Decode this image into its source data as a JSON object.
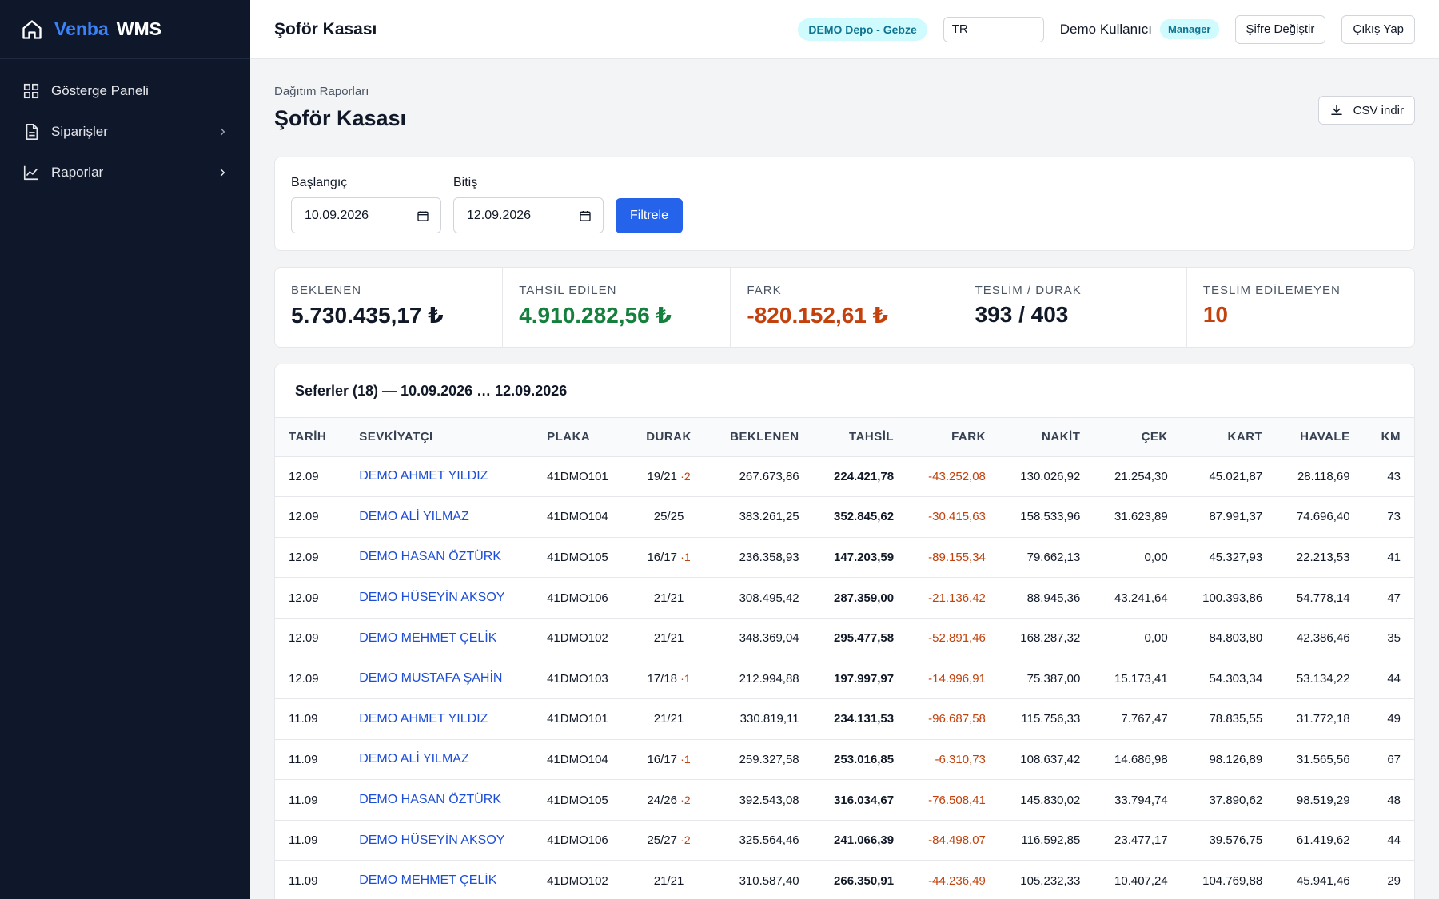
{
  "brand": {
    "part1": "Venba",
    "part2": "WMS"
  },
  "sidebar": {
    "items": [
      {
        "label": "Gösterge Paneli",
        "icon": "grid-icon"
      },
      {
        "label": "Siparişler",
        "icon": "document-icon",
        "has_children": true
      },
      {
        "label": "Raporlar",
        "icon": "chart-line-icon",
        "has_children": true
      }
    ]
  },
  "topbar": {
    "title": "Şoför Kasası",
    "depot": "DEMO Depo - Gebze",
    "language": "TR",
    "user": "Demo Kullanıcı",
    "role": "Manager",
    "change_password": "Şifre Değiştir",
    "logout": "Çıkış Yap"
  },
  "page": {
    "breadcrumb": "Dağıtım Raporları",
    "title": "Şoför Kasası",
    "csv_button": "CSV indir"
  },
  "filter": {
    "start_label": "Başlangıç",
    "start_value": "10.09.2026",
    "end_label": "Bitiş",
    "end_value": "12.09.2026",
    "button": "Filtrele"
  },
  "stats": [
    {
      "label": "BEKLENEN",
      "value": "5.730.435,17 ₺",
      "tone": ""
    },
    {
      "label": "TAHSİL EDİLEN",
      "value": "4.910.282,56 ₺",
      "tone": "green"
    },
    {
      "label": "FARK",
      "value": "-820.152,61 ₺",
      "tone": "red"
    },
    {
      "label": "TESLİM / DURAK",
      "value": "393 / 403",
      "tone": ""
    },
    {
      "label": "TESLİM EDİLEMEYEN",
      "value": "10",
      "tone": "red"
    }
  ],
  "trips": {
    "heading": "Seferler (18) — 10.09.2026 … 12.09.2026",
    "columns": [
      "TARİH",
      "SEVKİYATÇI",
      "PLAKA",
      "DURAK",
      "BEKLENEN",
      "TAHSİL",
      "FARK",
      "NAKİT",
      "ÇEK",
      "KART",
      "HAVALE",
      "KM"
    ],
    "rows": [
      {
        "date": "12.09",
        "driver": "DEMO AHMET YILDIZ",
        "plate": "41DMO101",
        "stops": "19/21",
        "missed": "·2",
        "expected": "267.673,86",
        "collected": "224.421,78",
        "diff": "-43.252,08",
        "cash": "130.026,92",
        "check": "21.254,30",
        "card": "45.021,87",
        "transfer": "28.118,69",
        "km": "43"
      },
      {
        "date": "12.09",
        "driver": "DEMO ALİ YILMAZ",
        "plate": "41DMO104",
        "stops": "25/25",
        "missed": "",
        "expected": "383.261,25",
        "collected": "352.845,62",
        "diff": "-30.415,63",
        "cash": "158.533,96",
        "check": "31.623,89",
        "card": "87.991,37",
        "transfer": "74.696,40",
        "km": "73"
      },
      {
        "date": "12.09",
        "driver": "DEMO HASAN ÖZTÜRK",
        "plate": "41DMO105",
        "stops": "16/17",
        "missed": "·1",
        "expected": "236.358,93",
        "collected": "147.203,59",
        "diff": "-89.155,34",
        "cash": "79.662,13",
        "check": "0,00",
        "card": "45.327,93",
        "transfer": "22.213,53",
        "km": "41"
      },
      {
        "date": "12.09",
        "driver": "DEMO HÜSEYİN AKSOY",
        "plate": "41DMO106",
        "stops": "21/21",
        "missed": "",
        "expected": "308.495,42",
        "collected": "287.359,00",
        "diff": "-21.136,42",
        "cash": "88.945,36",
        "check": "43.241,64",
        "card": "100.393,86",
        "transfer": "54.778,14",
        "km": "47"
      },
      {
        "date": "12.09",
        "driver": "DEMO MEHMET ÇELİK",
        "plate": "41DMO102",
        "stops": "21/21",
        "missed": "",
        "expected": "348.369,04",
        "collected": "295.477,58",
        "diff": "-52.891,46",
        "cash": "168.287,32",
        "check": "0,00",
        "card": "84.803,80",
        "transfer": "42.386,46",
        "km": "35"
      },
      {
        "date": "12.09",
        "driver": "DEMO MUSTAFA ŞAHİN",
        "plate": "41DMO103",
        "stops": "17/18",
        "missed": "·1",
        "expected": "212.994,88",
        "collected": "197.997,97",
        "diff": "-14.996,91",
        "cash": "75.387,00",
        "check": "15.173,41",
        "card": "54.303,34",
        "transfer": "53.134,22",
        "km": "44"
      },
      {
        "date": "11.09",
        "driver": "DEMO AHMET YILDIZ",
        "plate": "41DMO101",
        "stops": "21/21",
        "missed": "",
        "expected": "330.819,11",
        "collected": "234.131,53",
        "diff": "-96.687,58",
        "cash": "115.756,33",
        "check": "7.767,47",
        "card": "78.835,55",
        "transfer": "31.772,18",
        "km": "49"
      },
      {
        "date": "11.09",
        "driver": "DEMO ALİ YILMAZ",
        "plate": "41DMO104",
        "stops": "16/17",
        "missed": "·1",
        "expected": "259.327,58",
        "collected": "253.016,85",
        "diff": "-6.310,73",
        "cash": "108.637,42",
        "check": "14.686,98",
        "card": "98.126,89",
        "transfer": "31.565,56",
        "km": "67"
      },
      {
        "date": "11.09",
        "driver": "DEMO HASAN ÖZTÜRK",
        "plate": "41DMO105",
        "stops": "24/26",
        "missed": "·2",
        "expected": "392.543,08",
        "collected": "316.034,67",
        "diff": "-76.508,41",
        "cash": "145.830,02",
        "check": "33.794,74",
        "card": "37.890,62",
        "transfer": "98.519,29",
        "km": "48"
      },
      {
        "date": "11.09",
        "driver": "DEMO HÜSEYİN AKSOY",
        "plate": "41DMO106",
        "stops": "25/27",
        "missed": "·2",
        "expected": "325.564,46",
        "collected": "241.066,39",
        "diff": "-84.498,07",
        "cash": "116.592,85",
        "check": "23.477,17",
        "card": "39.576,75",
        "transfer": "61.419,62",
        "km": "44"
      },
      {
        "date": "11.09",
        "driver": "DEMO MEHMET ÇELİK",
        "plate": "41DMO102",
        "stops": "21/21",
        "missed": "",
        "expected": "310.587,40",
        "collected": "266.350,91",
        "diff": "-44.236,49",
        "cash": "105.232,33",
        "check": "10.407,24",
        "card": "104.769,88",
        "transfer": "45.941,46",
        "km": "29"
      }
    ]
  }
}
